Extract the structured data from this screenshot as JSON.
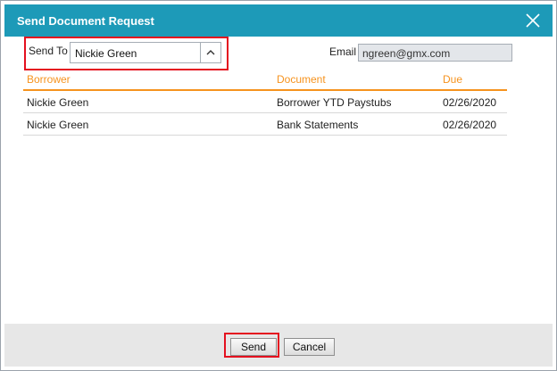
{
  "dialog": {
    "title": "Send Document Request",
    "close_icon": "close-icon",
    "title_bar_color": "#1d9ab8",
    "highlight_color": "#e4101f",
    "accent_color": "#f6931e"
  },
  "send_to": {
    "label": "Send To",
    "value": "Nickie Green",
    "toggle_icon": "chevron-up-icon"
  },
  "email": {
    "label": "Email",
    "value": "ngreen@gmx.com"
  },
  "table": {
    "headers": [
      "Borrower",
      "Document",
      "Due"
    ],
    "rows": [
      [
        "Nickie Green",
        "Borrower YTD Paystubs",
        "02/26/2020"
      ],
      [
        "Nickie Green",
        "Bank Statements",
        "02/26/2020"
      ]
    ]
  },
  "footer": {
    "send_label": "Send",
    "cancel_label": "Cancel"
  }
}
